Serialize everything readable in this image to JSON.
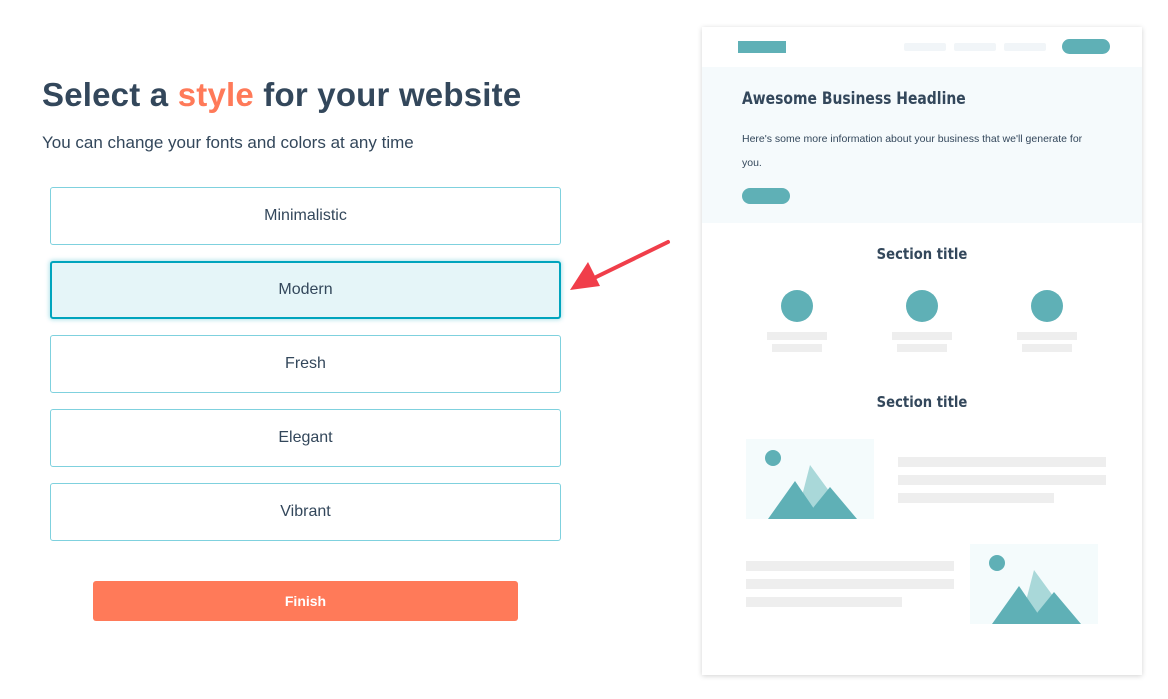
{
  "heading": {
    "before": "Select a ",
    "accent": "style",
    "after": " for your website"
  },
  "subheading": "You can change your fonts and colors at any time",
  "options": [
    {
      "label": "Minimalistic",
      "selected": false
    },
    {
      "label": "Modern",
      "selected": true
    },
    {
      "label": "Fresh",
      "selected": false
    },
    {
      "label": "Elegant",
      "selected": false
    },
    {
      "label": "Vibrant",
      "selected": false
    }
  ],
  "finish_label": "Finish",
  "preview": {
    "headline": "Awesome Business Headline",
    "subtext": "Here's some more information about your business that we'll generate for you.",
    "section_titles": [
      "Section title",
      "Section title"
    ]
  },
  "colors": {
    "text": "#33475b",
    "accent": "#ff7a59",
    "selected_border": "#00a4bd",
    "selected_bg": "#e5f5f8",
    "teal": "#5fb0b6",
    "arrow": "#f03e4a"
  },
  "icons": {
    "arrow": "pointer-arrow-icon",
    "image": "mountain-image-icon"
  }
}
